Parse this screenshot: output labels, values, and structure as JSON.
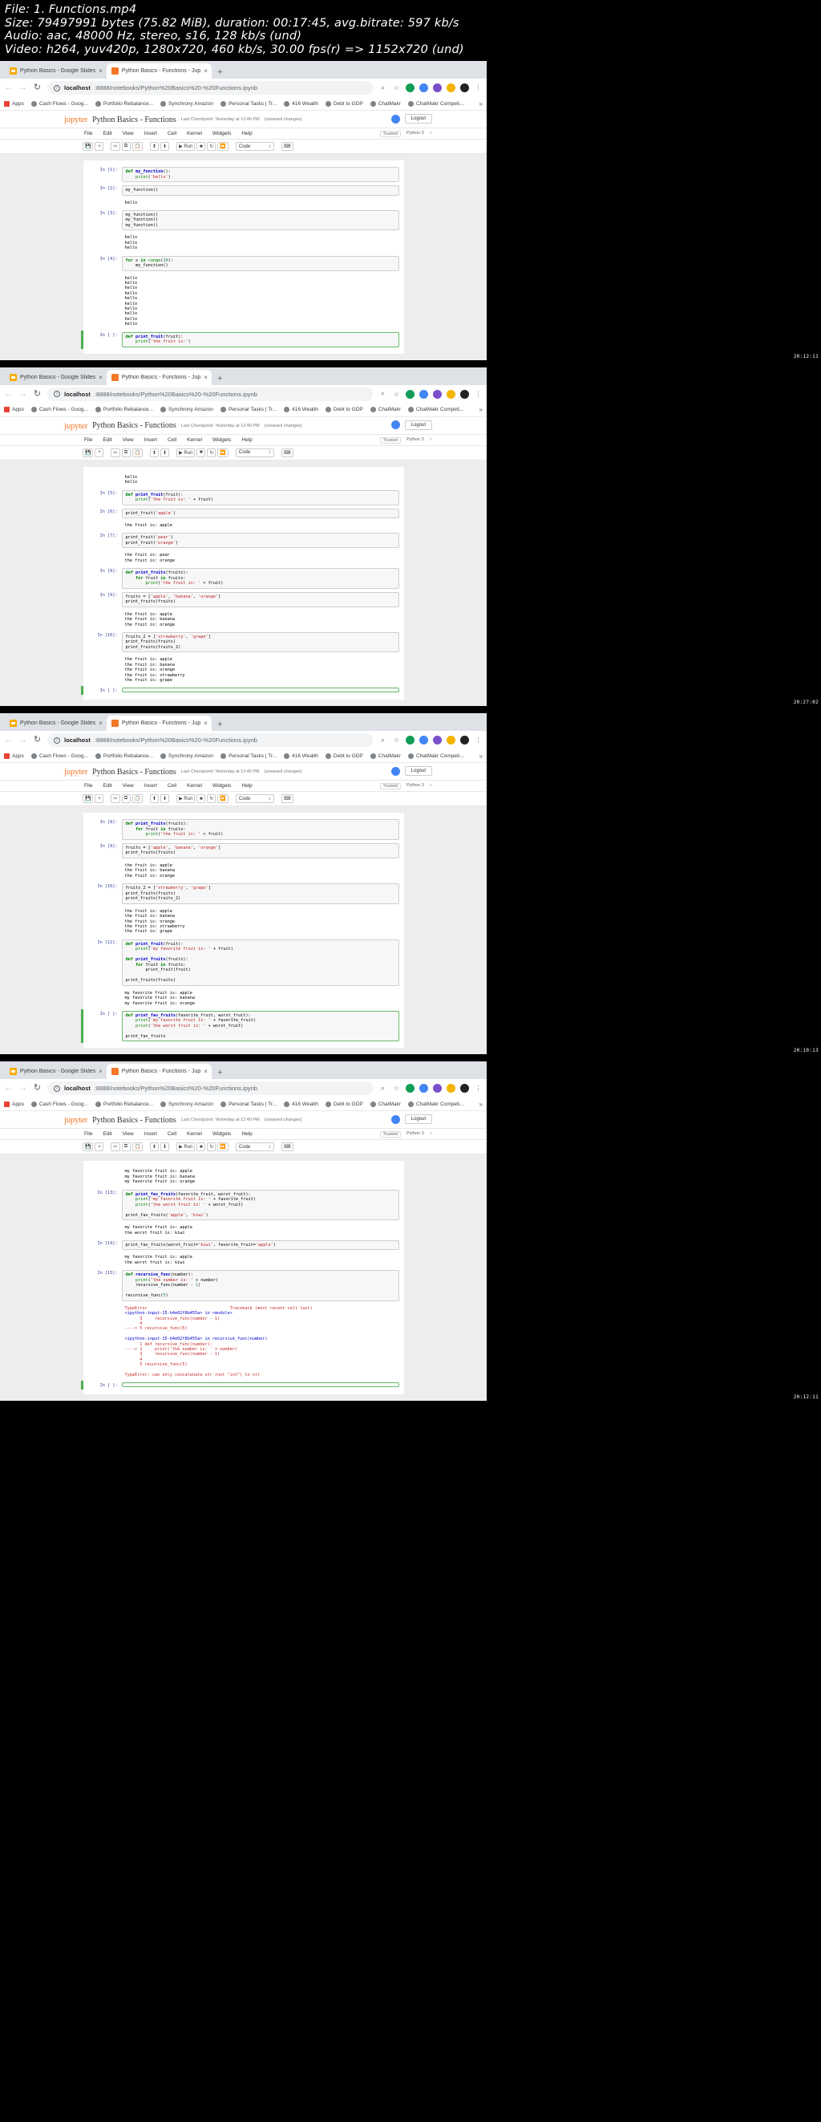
{
  "video_meta": {
    "line1": "File: 1. Functions.mp4",
    "line2": "Size: 79497991 bytes (75.82 MiB), duration: 00:17:45, avg.bitrate: 597 kb/s",
    "line3": "Audio: aac, 48000 Hz, stereo, s16, 128 kb/s (und)",
    "line4": "Video: h264, yuv420p, 1280x720, 460 kb/s, 30.00 fps(r) => 1152x720 (und)"
  },
  "browser": {
    "tabs": [
      {
        "label": "Python Basics - Google Slides",
        "favicon": "slides-icon",
        "active": false,
        "close": "×"
      },
      {
        "label": "Python Basics - Functions - Jup",
        "favicon": "jupyter-icon",
        "active": true,
        "close": "×"
      }
    ],
    "newtab_label": "+",
    "nav": {
      "back": "←",
      "forward": "→",
      "reload": "↻"
    },
    "omnibox": {
      "info_icon": "ⓘ",
      "host": "localhost",
      "path": ":8888/notebooks/Python%20Basics%20-%20Functions.ipynb"
    },
    "toolbar_icons": [
      {
        "name": "search-icon",
        "glyph": "⌕"
      },
      {
        "name": "bookmark-star-icon",
        "glyph": "☆"
      },
      {
        "name": "extension-green-icon",
        "glyph": "G"
      },
      {
        "name": "extension-blue-icon",
        "glyph": "B"
      },
      {
        "name": "extension-purple-icon",
        "glyph": "P"
      },
      {
        "name": "extension-orange-icon",
        "glyph": "O"
      },
      {
        "name": "profile-avatar-icon",
        "glyph": "●"
      },
      {
        "name": "chrome-menu-icon",
        "glyph": "⋮"
      }
    ],
    "bookmarks": [
      {
        "label": "Apps",
        "icon": "apps-grid-icon"
      },
      {
        "label": "Cash Flows - Goog...",
        "icon": "globe-icon"
      },
      {
        "label": "Portfolio Rebalance...",
        "icon": "globe-icon"
      },
      {
        "label": "Synchrony Amazon",
        "icon": "globe-icon"
      },
      {
        "label": "Personal Tasks | Tr...",
        "icon": "globe-icon"
      },
      {
        "label": "416 Wealth",
        "icon": "globe-icon"
      },
      {
        "label": "Debt to GDP",
        "icon": "globe-icon"
      },
      {
        "label": "ChatMakr",
        "icon": "globe-icon"
      },
      {
        "label": "ChatMakr Competi...",
        "icon": "globe-icon"
      }
    ],
    "bookmarks_overflow": "»"
  },
  "jupyter": {
    "logo": "jupyter",
    "title": "Python Basics - Functions",
    "checkpoint": "Last Checkpoint: Yesterday at 12:40 PM",
    "unsaved": "(unsaved changes)",
    "logout_label": "Logout",
    "menu": [
      "File",
      "Edit",
      "View",
      "Insert",
      "Cell",
      "Kernel",
      "Widgets",
      "Help"
    ],
    "trusted_label": "Trusted",
    "kernel_label": "Python 3",
    "kernel_idle_icon": "○",
    "toolbar": {
      "save_icon": "💾",
      "add_icon": "+",
      "cut_icon": "✂",
      "copy_icon": "⧉",
      "paste_icon": "📋",
      "up_icon": "⬆",
      "down_icon": "⬇",
      "run_label": "▶ Run",
      "stop_icon": "■",
      "restart_icon": "↻",
      "restart_run_icon": "⏩",
      "celltype_value": "Code",
      "celltype_chevron": "↕",
      "command_palette_icon": "⌨"
    }
  },
  "panels": [
    {
      "timestamp": "20:12:11",
      "cells": [
        {
          "type": "code",
          "prompt": "In [1]:",
          "lines": [
            "def my_function():",
            "    print('hello')"
          ]
        },
        {
          "type": "code",
          "prompt": "In [2]:",
          "lines": [
            "my_function()"
          ],
          "highlight": true
        },
        {
          "type": "output",
          "prompt": "",
          "lines": [
            "hello"
          ]
        },
        {
          "type": "code",
          "prompt": "In [3]:",
          "lines": [
            "my_function()",
            "my_function()",
            "my_function()"
          ]
        },
        {
          "type": "output",
          "prompt": "",
          "lines": [
            "hello",
            "hello",
            "hello"
          ]
        },
        {
          "type": "code",
          "prompt": "In [4]:",
          "lines": [
            "for x in range(10):",
            "    my_function()"
          ]
        },
        {
          "type": "output",
          "prompt": "",
          "lines": [
            "hello",
            "hello",
            "hello",
            "hello",
            "hello",
            "hello",
            "hello",
            "hello",
            "hello",
            "hello"
          ]
        },
        {
          "type": "code",
          "prompt": "In [ ]:",
          "lines": [
            "def print_fruit(fruit):",
            "    print('the fruit is:')"
          ],
          "selected": true
        }
      ]
    },
    {
      "timestamp": "20:27:02",
      "cells": [
        {
          "type": "output",
          "prompt": "",
          "lines": [
            "hello",
            "hello"
          ]
        },
        {
          "type": "code",
          "prompt": "In [5]:",
          "lines": [
            "def print_fruit(fruit):",
            "    print('the fruit is: ' + fruit)"
          ]
        },
        {
          "type": "code",
          "prompt": "In [6]:",
          "lines": [
            "print_fruit('apple')"
          ],
          "highlight": true
        },
        {
          "type": "output",
          "prompt": "",
          "lines": [
            "the fruit is: apple"
          ]
        },
        {
          "type": "code",
          "prompt": "In [7]:",
          "lines": [
            "print_fruit('pear')",
            "print_fruit('orange')"
          ]
        },
        {
          "type": "output",
          "prompt": "",
          "lines": [
            "the fruit is: pear",
            "the fruit is: orange"
          ]
        },
        {
          "type": "code",
          "prompt": "In [8]:",
          "lines": [
            "def print_fruits(fruits):",
            "    for fruit in fruits:",
            "        print('the fruit is: ' + fruit)"
          ],
          "highlight": true
        },
        {
          "type": "code",
          "prompt": "In [9]:",
          "lines": [
            "fruits = ['apple', 'banana', 'orange']",
            "print_fruits(fruits)"
          ],
          "highlight": true
        },
        {
          "type": "output",
          "prompt": "",
          "lines": [
            "the fruit is: apple",
            "the fruit is: banana",
            "the fruit is: orange"
          ]
        },
        {
          "type": "code",
          "prompt": "In [10]:",
          "lines": [
            "fruits_2 = ['strawberry', 'grape']",
            "print_fruits(fruits)",
            "print_fruits(fruits_2)"
          ],
          "highlight": true
        },
        {
          "type": "output",
          "prompt": "",
          "lines": [
            "the fruit is: apple",
            "the fruit is: banana",
            "the fruit is: orange",
            "the fruit is: strawberry",
            "the fruit is: grape"
          ]
        },
        {
          "type": "code",
          "prompt": "In [ ]:",
          "lines": [
            ""
          ],
          "selected": true
        }
      ]
    },
    {
      "timestamp": "20:10:13",
      "cells": [
        {
          "type": "code",
          "prompt": "In [8]:",
          "lines": [
            "def print_fruits(fruits):",
            "    for fruit in fruits:",
            "        print('the fruit is: ' + fruit)"
          ],
          "highlight": true
        },
        {
          "type": "code",
          "prompt": "In [9]:",
          "lines": [
            "fruits = ['apple', 'banana', 'orange']",
            "print_fruits(fruits)"
          ],
          "highlight": true
        },
        {
          "type": "output",
          "prompt": "",
          "lines": [
            "the fruit is: apple",
            "the fruit is: banana",
            "the fruit is: orange"
          ]
        },
        {
          "type": "code",
          "prompt": "In [10]:",
          "lines": [
            "fruits_2 = ['strawberry', 'grape']",
            "print_fruits(fruits)",
            "print_fruits(fruits_2)"
          ],
          "highlight": true
        },
        {
          "type": "output",
          "prompt": "",
          "lines": [
            "the fruit is: apple",
            "the fruit is: banana",
            "the fruit is: orange",
            "the fruit is: strawberry",
            "the fruit is: grape"
          ]
        },
        {
          "type": "code",
          "prompt": "In [12]:",
          "lines": [
            "def print_fruit(fruit):",
            "    print('my favorite fruit is: ' + fruit)",
            "",
            "def print_fruits(fruits):",
            "    for fruit in fruits:",
            "        print_fruit(fruit)",
            "",
            "print_fruits(fruits)"
          ]
        },
        {
          "type": "output",
          "prompt": "",
          "lines": [
            "my favorite fruit is: apple",
            "my favorite fruit is: banana",
            "my favorite fruit is: orange"
          ]
        },
        {
          "type": "code",
          "prompt": "In [ ]:",
          "lines": [
            "def print_fav_fruits(favorite_fruit, worst_fruit):",
            "    print('my favorite fruit is: ' + favorite_fruit)",
            "    print('the worst fruit is: ' + worst_fruit)",
            "",
            "print_fav_fruits"
          ],
          "selected": true
        }
      ]
    },
    {
      "timestamp": "20:12:11",
      "cells": [
        {
          "type": "output",
          "prompt": "",
          "lines": [
            "my favorite fruit is: apple",
            "my favorite fruit is: banana",
            "my favorite fruit is: orange"
          ]
        },
        {
          "type": "code",
          "prompt": "In [13]:",
          "lines": [
            "def print_fav_fruits(favorite_fruit, worst_fruit):",
            "    print('my favorite fruit is: ' + favorite_fruit)",
            "    print('the worst fruit is: ' + worst_fruit)",
            "",
            "print_fav_fruits('apple', 'kiwi')"
          ],
          "highlight": true
        },
        {
          "type": "output",
          "prompt": "",
          "lines": [
            "my favorite fruit is: apple",
            "the worst fruit is: kiwi"
          ]
        },
        {
          "type": "code",
          "prompt": "In [14]:",
          "lines": [
            "print_fav_fruits(worst_fruit='kiwi', favorite_fruit='apple')"
          ]
        },
        {
          "type": "output",
          "prompt": "",
          "lines": [
            "my favorite fruit is: apple",
            "the worst fruit is: kiwi"
          ]
        },
        {
          "type": "code",
          "prompt": "In [15]:",
          "lines": [
            "def recursive_func(number):",
            "    print('the number is: ' + number)",
            "    recursive_func(number - 1)",
            "",
            "recursive_func(5)"
          ]
        },
        {
          "type": "error",
          "prompt": "",
          "lines": [
            "TypeError                                 Traceback (most recent call last)",
            "<ipython-input-15-b4e02f8b455a> in <module>",
            "      3     recursive_func(number - 1)",
            "      4 ",
            "----> 5 recursive_func(5)",
            "",
            "<ipython-input-15-b4e02f8b455a> in recursive_func(number)",
            "      1 def recursive_func(number):",
            "----> 2     print('the number is: ' + number)",
            "      3     recursive_func(number - 1)",
            "      4 ",
            "      5 recursive_func(5)",
            "",
            "TypeError: can only concatenate str (not \"int\") to str"
          ]
        },
        {
          "type": "code",
          "prompt": "In [ ]:",
          "lines": [
            ""
          ],
          "selected": true
        }
      ]
    }
  ]
}
